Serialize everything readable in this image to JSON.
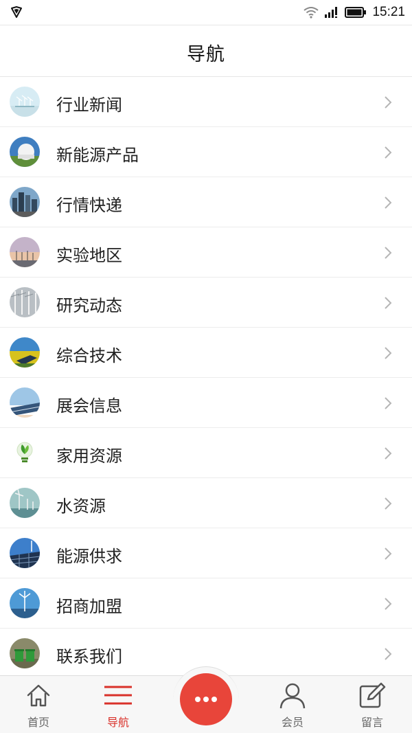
{
  "status_bar": {
    "time": "15:21"
  },
  "header": {
    "title": "导航"
  },
  "list": {
    "items": [
      {
        "label": "行业新闻",
        "icon": "wind-turbine-sky-thumb"
      },
      {
        "label": "新能源产品",
        "icon": "dome-building-thumb"
      },
      {
        "label": "行情快递",
        "icon": "city-skyline-thumb"
      },
      {
        "label": "实验地区",
        "icon": "windfarm-sunset-thumb"
      },
      {
        "label": "研究动态",
        "icon": "turbine-blades-thumb"
      },
      {
        "label": "综合技术",
        "icon": "solar-field-thumb"
      },
      {
        "label": "展会信息",
        "icon": "solar-panels-thumb"
      },
      {
        "label": "家用资源",
        "icon": "green-bulb-thumb"
      },
      {
        "label": "水资源",
        "icon": "offshore-turbine-thumb"
      },
      {
        "label": "能源供求",
        "icon": "solar-turbine-thumb"
      },
      {
        "label": "招商加盟",
        "icon": "turbine-ocean-thumb"
      },
      {
        "label": "联系我们",
        "icon": "recycle-bins-thumb"
      }
    ]
  },
  "bottom_nav": {
    "tabs": [
      {
        "label": "首页",
        "icon": "home-icon"
      },
      {
        "label": "导航",
        "icon": "menu-icon",
        "active": true
      },
      {
        "label": "",
        "icon": "more-dots-icon"
      },
      {
        "label": "会员",
        "icon": "user-icon"
      },
      {
        "label": "留言",
        "icon": "edit-icon"
      }
    ]
  },
  "colors": {
    "accent": "#d9312a",
    "fab": "#e8453a"
  }
}
